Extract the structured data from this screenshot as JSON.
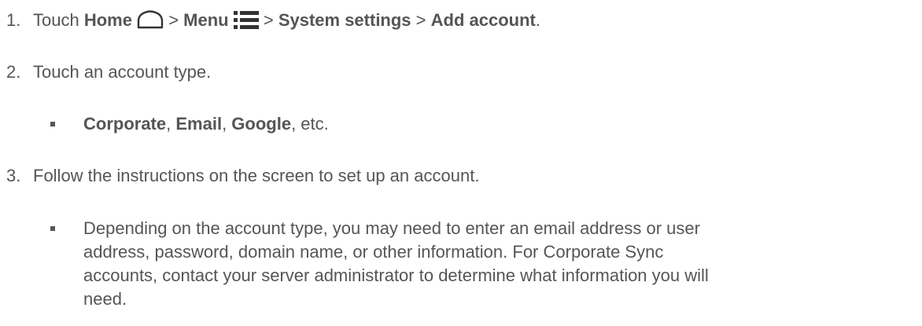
{
  "steps": [
    {
      "number": "1.",
      "parts": {
        "touch": "Touch ",
        "home": "Home",
        "sep1": " > ",
        "menu": "Menu",
        "sep2": " > ",
        "system_settings": "System settings",
        "sep3": " > ",
        "add_account": "Add account",
        "end": "."
      },
      "icons": [
        "home-icon",
        "menu-icon"
      ]
    },
    {
      "number": "2.",
      "text": "Touch an account type.",
      "bullet": {
        "corporate": "Corporate",
        "comma1": ", ",
        "email": "Email",
        "comma2": ", ",
        "google": "Google",
        "rest": ", etc."
      }
    },
    {
      "number": "3.",
      "text": "Follow the instructions on the screen to set up an account.",
      "bullet": {
        "line1": "Depending on the account type, you may need to enter an email address or user",
        "line2": "address, password, domain name, or other information. For Corporate Sync",
        "line3": "accounts, contact your server administrator to determine what information you will",
        "line4": "need."
      }
    }
  ],
  "colors": {
    "text": "#555555",
    "icon": "#333333"
  }
}
